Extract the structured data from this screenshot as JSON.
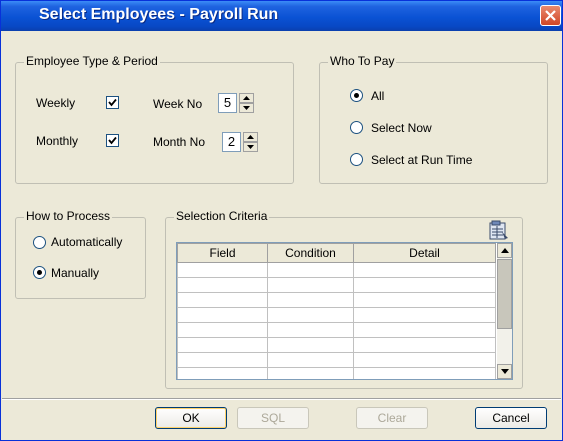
{
  "window": {
    "title": "Select Employees - Payroll Run"
  },
  "employee_group": {
    "legend": "Employee Type & Period",
    "weekly_label": "Weekly",
    "weekly_checked": true,
    "monthly_label": "Monthly",
    "monthly_checked": true,
    "week_no_label": "Week No",
    "week_no_value": "5",
    "month_no_label": "Month No",
    "month_no_value": "2"
  },
  "who_to_pay": {
    "legend": "Who To Pay",
    "options": [
      {
        "label": "All",
        "selected": true
      },
      {
        "label": "Select Now",
        "selected": false
      },
      {
        "label": "Select at Run Time",
        "selected": false
      }
    ]
  },
  "how_to_process": {
    "legend": "How to Process",
    "options": [
      {
        "label": "Automatically",
        "selected": false
      },
      {
        "label": "Manually",
        "selected": true
      }
    ]
  },
  "selection_criteria": {
    "legend": "Selection Criteria",
    "columns": [
      "Field",
      "Condition",
      "Detail"
    ],
    "row_count": 8
  },
  "buttons": {
    "ok": "OK",
    "sql": "SQL",
    "clear": "Clear",
    "cancel": "Cancel"
  },
  "colors": {
    "titlebar": "#0a52d4",
    "dialog_bg": "#ece9d8",
    "close_button": "#d14624"
  }
}
